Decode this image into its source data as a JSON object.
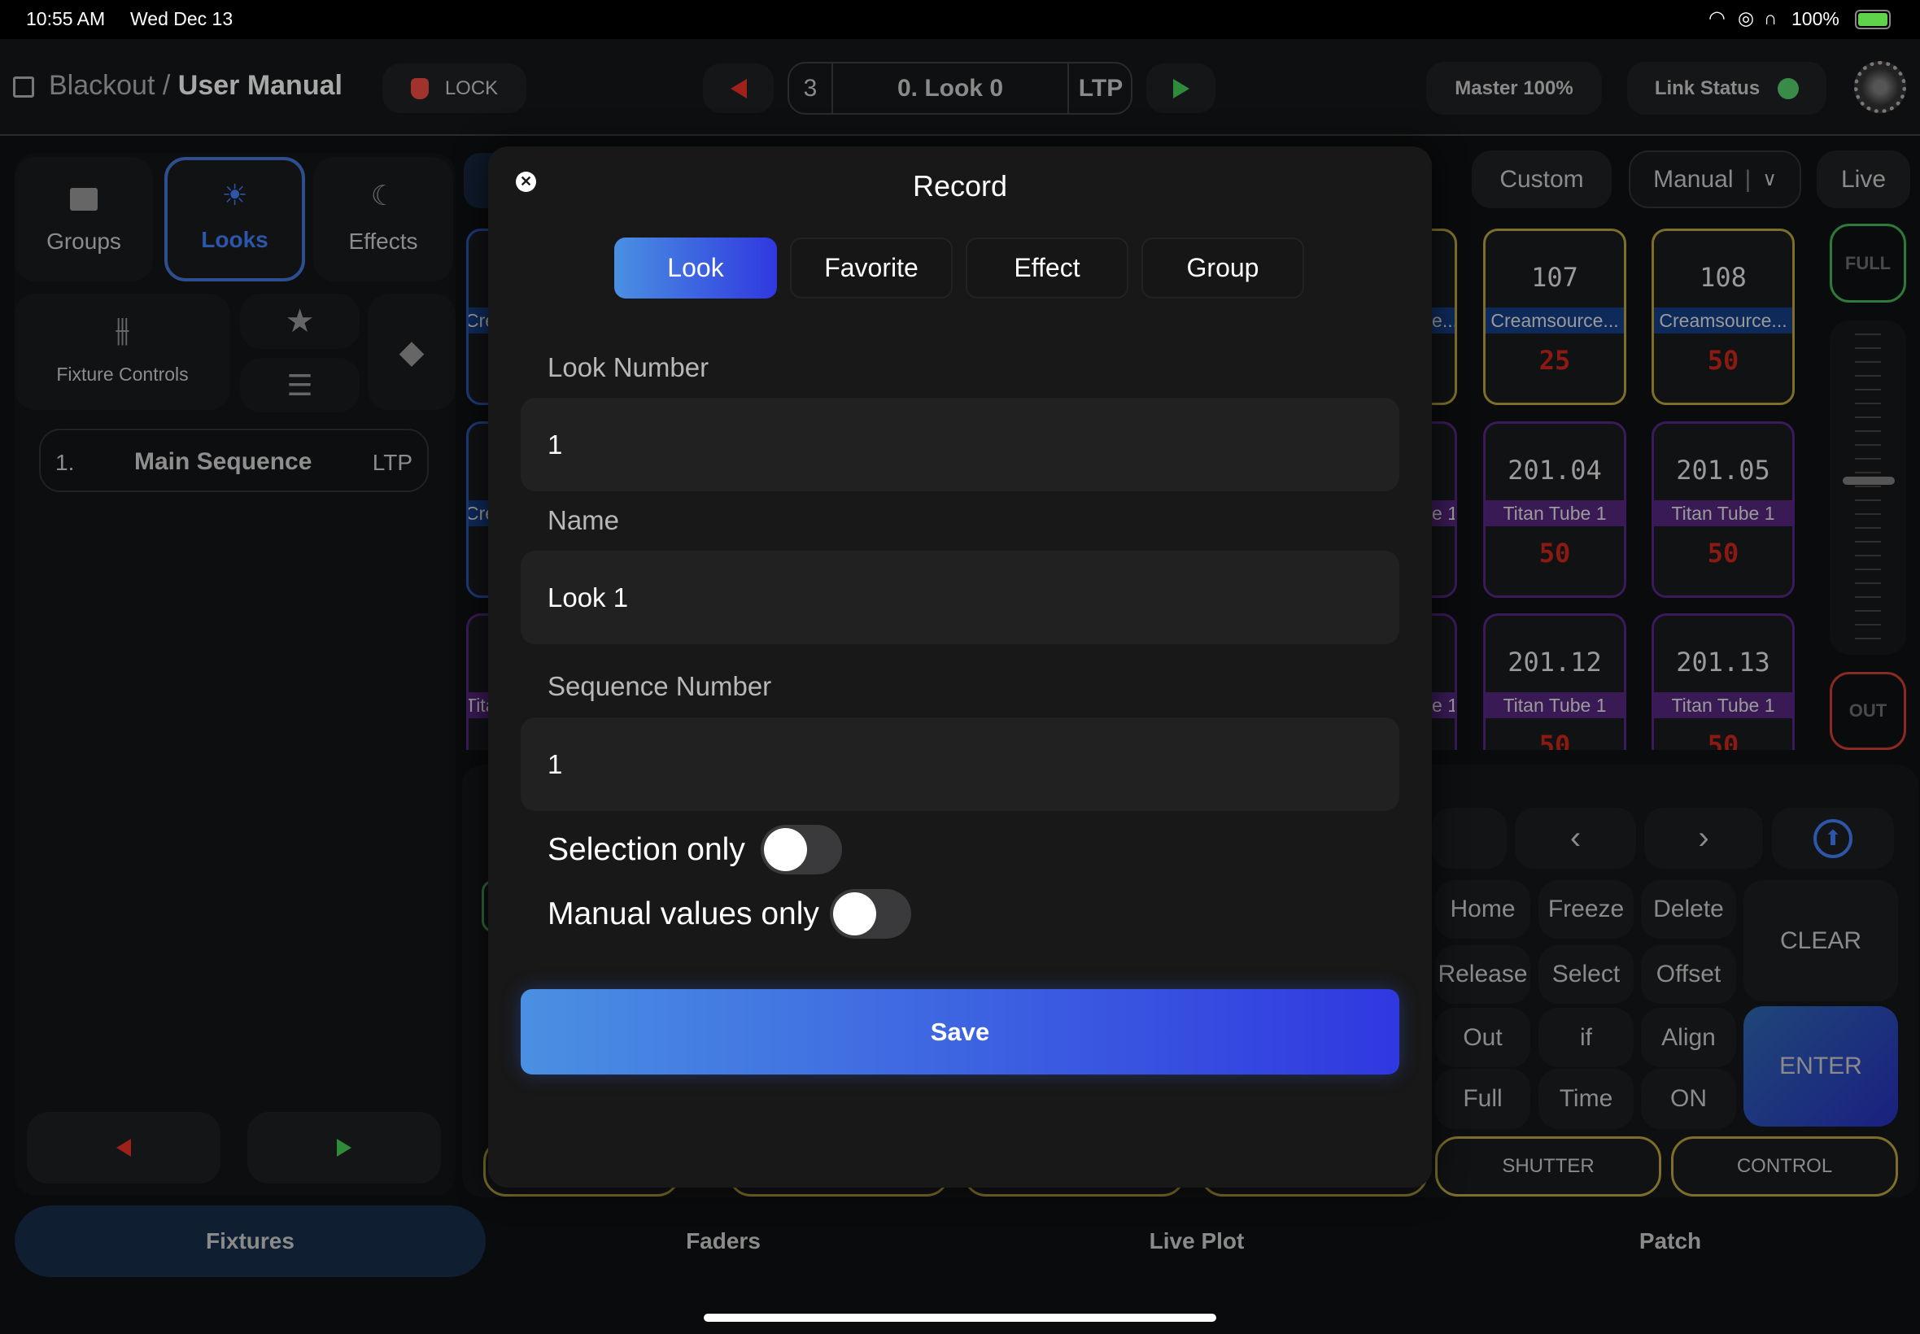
{
  "status_bar": {
    "time": "10:55 AM",
    "date": "Wed Dec 13",
    "battery": "100%"
  },
  "header": {
    "breadcrumb_parent": "Blackout",
    "separator": "/",
    "title": "User Manual",
    "lock_label": "LOCK",
    "sequence": {
      "number": "3",
      "look": "0. Look 0",
      "mode": "LTP"
    },
    "master": "Master 100%",
    "link_status": "Link Status",
    "colors": {
      "lock": "#a0342c",
      "prev": "#a0201a",
      "next": "#2f8a3a",
      "link_ok": "#3a8a4a"
    }
  },
  "left_panel": {
    "tiles": [
      {
        "label": "Groups",
        "icon": "folder-icon"
      },
      {
        "label": "Looks",
        "icon": "lightbulb-icon",
        "active": true
      },
      {
        "label": "Effects",
        "icon": "moon-stars-icon"
      }
    ],
    "fixture_controls": "Fixture Controls",
    "sequences": [
      {
        "num": "1.",
        "name": "Main Sequence",
        "mode": "LTP"
      }
    ]
  },
  "view_buttons": {
    "custom": "Custom",
    "manual": "Manual",
    "live": "Live"
  },
  "fixtures": [
    {
      "id": "107",
      "name": "Creamsource...",
      "value": "25",
      "kind": "creamsource"
    },
    {
      "id": "108",
      "name": "Creamsource...",
      "value": "50",
      "kind": "creamsource"
    },
    {
      "id": "201.04",
      "name": "Titan Tube 1",
      "value": "50",
      "kind": "titan"
    },
    {
      "id": "201.05",
      "name": "Titan Tube 1",
      "value": "50",
      "kind": "titan"
    },
    {
      "id": "201.12",
      "name": "Titan Tube 1",
      "value": "50",
      "kind": "titan"
    },
    {
      "id": "201.13",
      "name": "Titan Tube 1",
      "value": "50",
      "kind": "titan"
    }
  ],
  "hidden_fixtures": {
    "creamsource": "Creamsource...",
    "titan": "Titan Tube 1"
  },
  "fader": {
    "full": "FULL",
    "out": "OUT",
    "level": 0.5
  },
  "keypad": {
    "keys": [
      "Home",
      "Freeze",
      "Delete",
      "Release",
      "Select",
      "Offset",
      "Out",
      "if",
      "Align",
      "Full",
      "Time",
      "ON"
    ],
    "clear": "CLEAR",
    "enter": "ENTER",
    "shutter": "SHUTTER",
    "control": "CONTROL"
  },
  "modal": {
    "title": "Record",
    "tabs": [
      "Look",
      "Favorite",
      "Effect",
      "Group"
    ],
    "active_tab": "Look",
    "fields": [
      {
        "label": "Look Number",
        "value": "1"
      },
      {
        "label": "Name",
        "value": "Look 1"
      },
      {
        "label": "Sequence Number",
        "value": "1"
      }
    ],
    "toggles": [
      {
        "label": "Selection only",
        "on": false
      },
      {
        "label": "Manual values only",
        "on": false
      }
    ],
    "save": "Save",
    "colors": {
      "gradient_start": "#4a90e2",
      "gradient_end": "#3038e0"
    }
  },
  "bottom_tabs": [
    {
      "label": "Fixtures",
      "active": true
    },
    {
      "label": "Faders"
    },
    {
      "label": "Live Plot"
    },
    {
      "label": "Patch"
    }
  ]
}
